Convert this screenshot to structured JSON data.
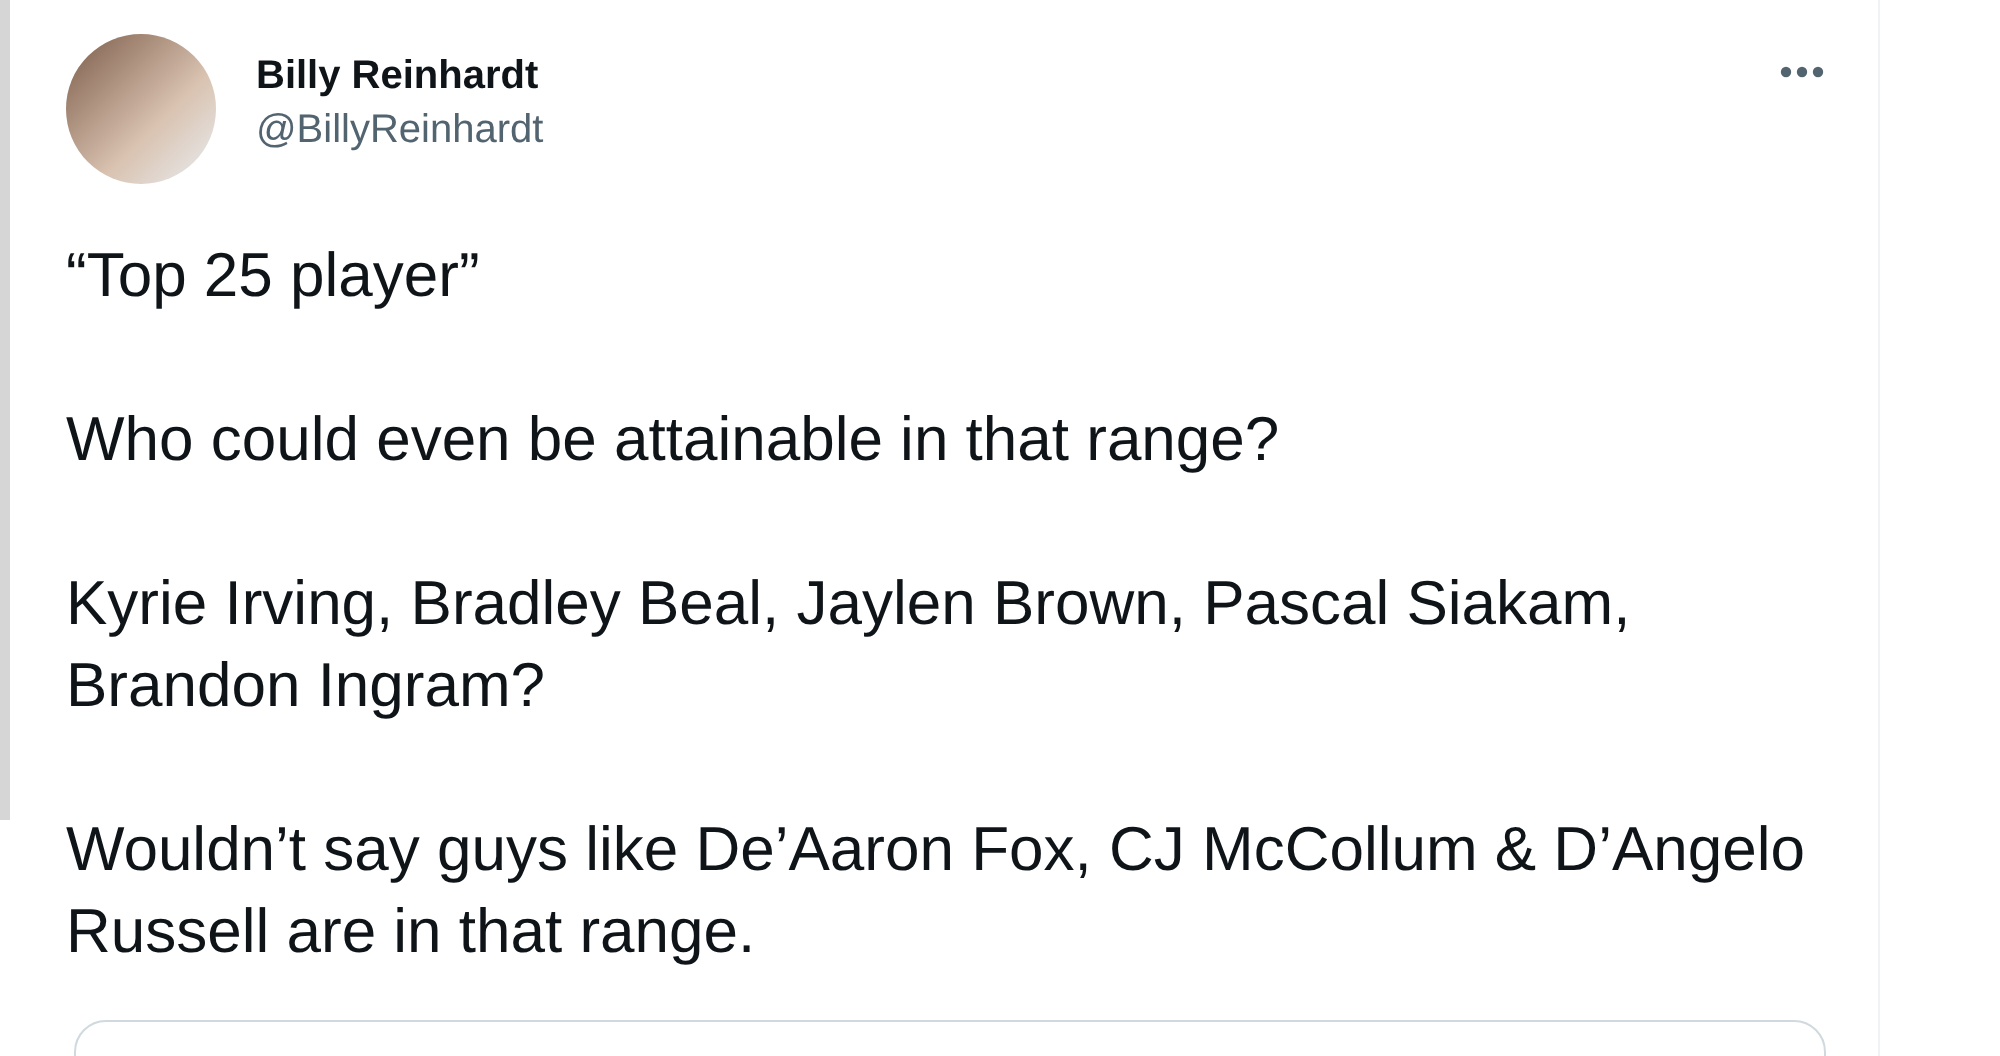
{
  "author": {
    "name": "Billy Reinhardt",
    "handle": "@BillyReinhardt"
  },
  "paragraphs": [
    "“Top 25 player”",
    "Who could even be attainable in that range?",
    "Kyrie Irving, Bradley Beal, Jaylen Brown, Pascal Siakam, Brandon Ingram?",
    "Wouldn’t say guys like De’Aaron Fox, CJ McCollum & D’Angelo Russell are in that range."
  ]
}
